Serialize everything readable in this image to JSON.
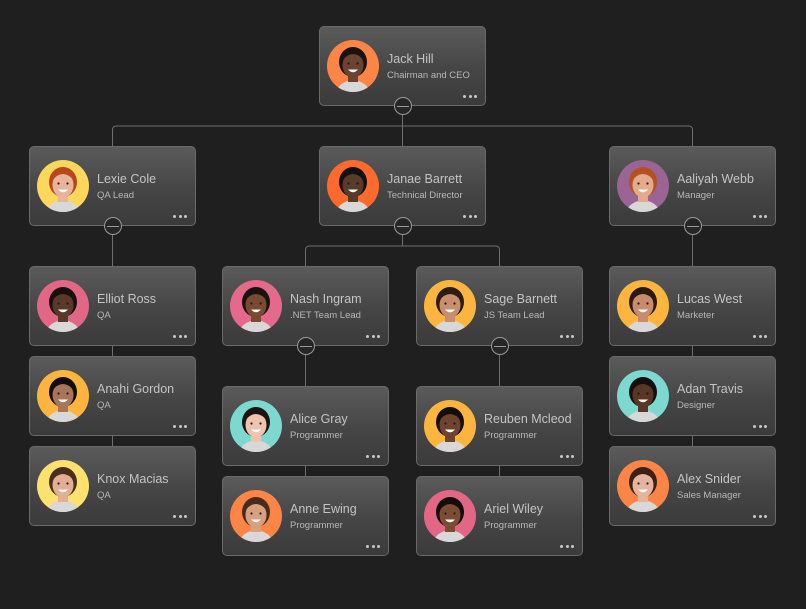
{
  "chart": {
    "type": "org-chart",
    "theme_colors": {
      "background": "#1f1f1f",
      "card_border": "#6a6a6a",
      "connector": "#6e6e6e",
      "name_text": "#c4c4c4",
      "title_text": "#b8b8b8"
    },
    "nodes": [
      {
        "id": "jack",
        "name": "Jack Hill",
        "title": "Chairman and CEO",
        "parent": null,
        "avatar_color": "#fe8546",
        "skin": "#6b4330",
        "hair": "#1a1210",
        "expanded": true
      },
      {
        "id": "lexie",
        "name": "Lexie Cole",
        "title": "QA Lead",
        "parent": "jack",
        "avatar_color": "#fcd75c",
        "skin": "#e9b59a",
        "hair": "#b8461f",
        "expanded": true
      },
      {
        "id": "janae",
        "name": "Janae Barrett",
        "title": "Technical Director",
        "parent": "jack",
        "avatar_color": "#fe6a2d",
        "skin": "#5a3a28",
        "hair": "#141010",
        "expanded": true
      },
      {
        "id": "aaliyah",
        "name": "Aaliyah Webb",
        "title": "Manager",
        "parent": "jack",
        "avatar_color": "#9a6494",
        "skin": "#e3ab8d",
        "hair": "#b4521f",
        "expanded": true
      },
      {
        "id": "elliot",
        "name": "Elliot Ross",
        "title": "QA",
        "parent": "lexie",
        "avatar_color": "#e26784",
        "skin": "#5b3928",
        "hair": "#161010"
      },
      {
        "id": "anahi",
        "name": "Anahi Gordon",
        "title": "QA",
        "parent": "lexie",
        "avatar_color": "#fdb53f",
        "skin": "#a9745a",
        "hair": "#120d0c"
      },
      {
        "id": "knox",
        "name": "Knox Macias",
        "title": "QA",
        "parent": "lexie",
        "avatar_color": "#fde16e",
        "skin": "#e4ae92",
        "hair": "#4a2e20"
      },
      {
        "id": "nash",
        "name": "Nash Ingram",
        "title": ".NET Team Lead",
        "parent": "janae",
        "avatar_color": "#e4698a",
        "skin": "#7a4a32",
        "hair": "#1a1210",
        "expanded": true
      },
      {
        "id": "sage",
        "name": "Sage Barnett",
        "title": "JS Team Lead",
        "parent": "janae",
        "avatar_color": "#fdb53f",
        "skin": "#c98f6c",
        "hair": "#2a1c16",
        "expanded": true
      },
      {
        "id": "alice",
        "name": "Alice Gray",
        "title": "Programmer",
        "parent": "nash",
        "avatar_color": "#7dd9d0",
        "skin": "#efc3ad",
        "hair": "#1c1412"
      },
      {
        "id": "anne",
        "name": "Anne Ewing",
        "title": "Programmer",
        "parent": "nash",
        "avatar_color": "#fe8546",
        "skin": "#d9a07f",
        "hair": "#4a2c1c"
      },
      {
        "id": "reuben",
        "name": "Reuben Mcleod",
        "title": "Programmer",
        "parent": "sage",
        "avatar_color": "#fdb53f",
        "skin": "#6e4430",
        "hair": "#130e0c"
      },
      {
        "id": "ariel",
        "name": "Ariel Wiley",
        "title": "Programmer",
        "parent": "sage",
        "avatar_color": "#e26784",
        "skin": "#7c4c34",
        "hair": "#120d0b"
      },
      {
        "id": "lucas",
        "name": "Lucas West",
        "title": "Marketer",
        "parent": "aaliyah",
        "avatar_color": "#fdb53f",
        "skin": "#c88c6c",
        "hair": "#2a1a14"
      },
      {
        "id": "adan",
        "name": "Adan Travis",
        "title": "Designer",
        "parent": "aaliyah",
        "avatar_color": "#7dd9d0",
        "skin": "#5a3624",
        "hair": "#141010"
      },
      {
        "id": "alex",
        "name": "Alex Snider",
        "title": "Sales Manager",
        "parent": "aaliyah",
        "avatar_color": "#fe8546",
        "skin": "#e6b49c",
        "hair": "#3a2218"
      }
    ],
    "more_icon": "ellipsis-horizontal",
    "toggle_icon": "collapse-minus-circle"
  }
}
